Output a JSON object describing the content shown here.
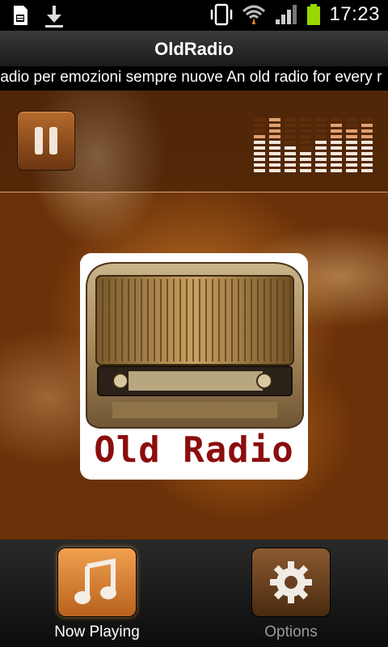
{
  "status_bar": {
    "time": "17:23",
    "icons": [
      "sd-card-icon",
      "download-icon",
      "vibrate-icon",
      "wifi-icon",
      "signal-icon",
      "battery-icon"
    ]
  },
  "app": {
    "title": "OldRadio",
    "ticker_text": "radio per emozioni sempre nuove An old radio for every r"
  },
  "player": {
    "state": "playing",
    "artwork_text": "Old Radio"
  },
  "tabs": [
    {
      "label": "Now Playing",
      "icon": "music-note-icon",
      "active": true
    },
    {
      "label": "Options",
      "icon": "gear-icon",
      "active": false
    }
  ],
  "colors": {
    "accent": "#e08a3a",
    "artwork_text": "#8b0d0d"
  }
}
